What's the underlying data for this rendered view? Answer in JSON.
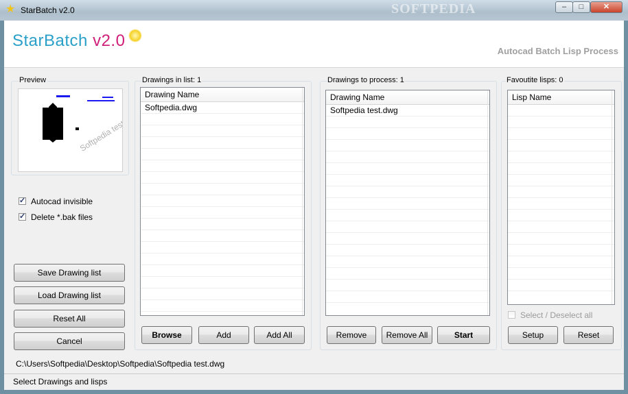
{
  "window": {
    "title": "StarBatch v2.0",
    "watermark": "SOFTPEDIA",
    "controls": {
      "minimize": "–",
      "maximize": "□",
      "close": "✕"
    }
  },
  "banner": {
    "logo_main": "StarBatch ",
    "logo_version": "v2.0",
    "subtitle": "Autocad Batch Lisp Process"
  },
  "preview": {
    "label": "Preview",
    "drawing_text": "Softpedia test"
  },
  "options": {
    "autocad_invisible": {
      "label": "Autocad invisible",
      "checked": true
    },
    "delete_bak": {
      "label": "Delete *.bak files",
      "checked": true
    }
  },
  "left_buttons": {
    "save": "Save Drawing  list",
    "load": "Load Drawing list",
    "reset_all": "Reset All",
    "cancel": "Cancel"
  },
  "drawings_in_list": {
    "label": "Drawings in list: 1",
    "column": "Drawing Name",
    "rows": [
      "Softpedia.dwg"
    ],
    "buttons": {
      "browse": "Browse",
      "add": "Add",
      "add_all": "Add All"
    }
  },
  "drawings_to_process": {
    "label": "Drawings to process: 1",
    "column": "Drawing Name",
    "rows": [
      "Softpedia test.dwg"
    ],
    "buttons": {
      "remove": "Remove",
      "remove_all": "Remove All",
      "start": "Start"
    }
  },
  "favourite_lisps": {
    "label": "Favoutite lisps: 0",
    "column": "Lisp Name",
    "rows": [],
    "select_all": {
      "label": "Select / Deselect all",
      "checked": false,
      "enabled": false
    },
    "buttons": {
      "setup": "Setup",
      "reset": "Reset"
    }
  },
  "path": "C:\\Users\\Softpedia\\Desktop\\Softpedia\\Softpedia test.dwg",
  "status": "Select Drawings and lisps",
  "icons": {
    "app": "star-icon",
    "sun": "sun-icon"
  },
  "colors": {
    "logo_blue": "#2aa0c8",
    "logo_pink": "#d0207a",
    "subtitle": "#a0a0a0"
  }
}
